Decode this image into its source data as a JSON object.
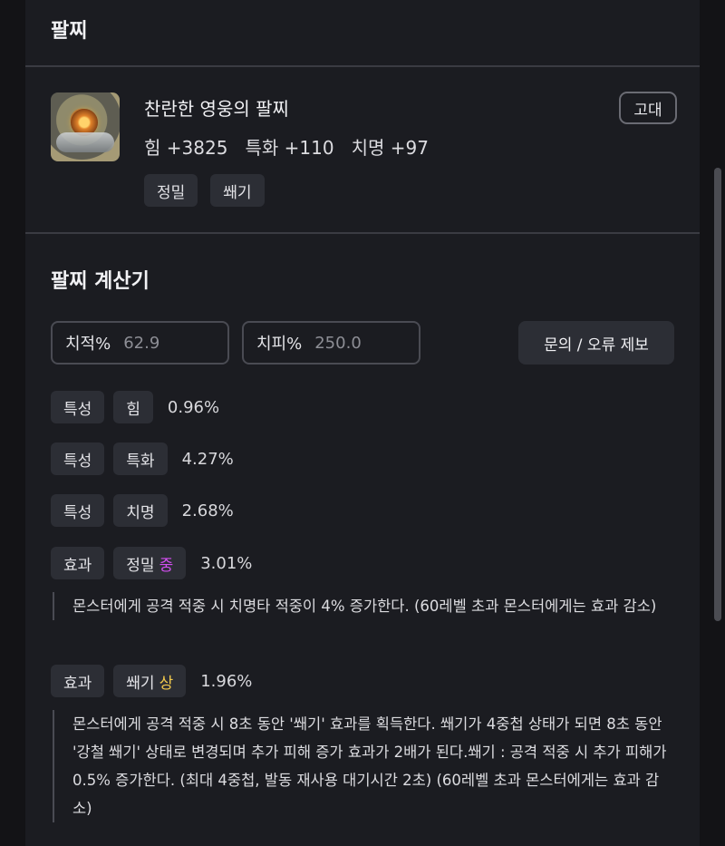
{
  "header": {
    "title": "팔찌"
  },
  "item": {
    "name": "찬란한 영웅의 팔찌",
    "stats": "힘 +3825   특화 +110   치명 +97",
    "grade": "고대",
    "tags": [
      "정밀",
      "쐐기"
    ]
  },
  "calculator": {
    "title": "팔찌 계산기",
    "crit_rate": {
      "label": "치적%",
      "value": "62.9"
    },
    "crit_damage": {
      "label": "치피%",
      "value": "250.0"
    },
    "report_button": "문의 / 오류 제보",
    "rows": [
      {
        "type": "특성",
        "name": "힘",
        "percent": "0.96%"
      },
      {
        "type": "특성",
        "name": "특화",
        "percent": "4.27%"
      },
      {
        "type": "특성",
        "name": "치명",
        "percent": "2.68%"
      },
      {
        "type": "효과",
        "name": "정밀",
        "tier": "중",
        "percent": "3.01%",
        "description": "몬스터에게 공격 적중 시 치명타 적중이 4% 증가한다. (60레벨 초과 몬스터에게는 효과 감소)"
      },
      {
        "type": "효과",
        "name": "쐐기",
        "tier": "상",
        "percent": "1.96%",
        "description": "몬스터에게 공격 적중 시 8초 동안 '쐐기' 효과를 획득한다. 쐐기가 4중첩 상태가 되면 8초 동안 '강철 쐐기' 상태로 변경되며 추가 피해 증가 효과가 2배가 된다.쐐기 : 공격 적중 시 추가 피해가 0.5% 증가한다. (최대 4중첩, 발동 재사용 대기시간 2초) (60레벨 초과 몬스터에게는 효과 감소)"
      }
    ]
  },
  "colors": {
    "tier_mid": "#d24ff0",
    "tier_high": "#f2c94c",
    "background": "#1b1c21",
    "chip": "#2c2e35"
  }
}
